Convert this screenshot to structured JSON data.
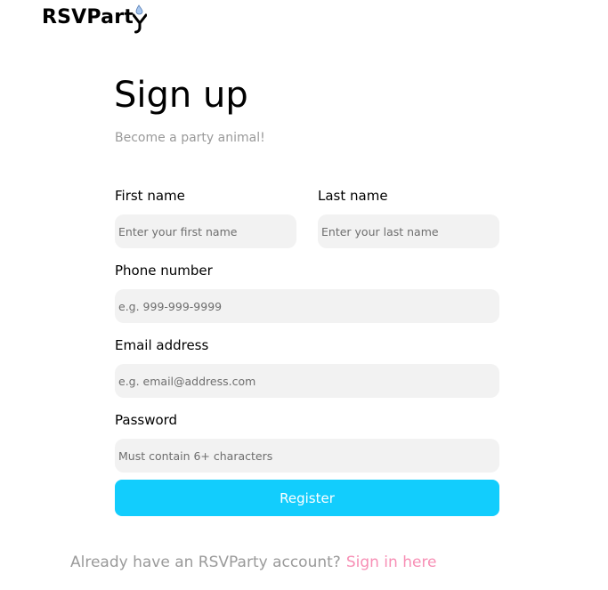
{
  "brand": {
    "name": "RSVParty",
    "text_before_mark": "RSVPart",
    "colors": {
      "accent": "#12cdfd",
      "link": "#f78fb5",
      "muted": "#9a9a9a",
      "field_bg": "#f2f2f2",
      "mark_drop": "#a8c8f0"
    }
  },
  "header": {
    "title": "Sign up",
    "subtitle": "Become a party animal!"
  },
  "form": {
    "first_name": {
      "label": "First name",
      "placeholder": "Enter your first name",
      "value": ""
    },
    "last_name": {
      "label": "Last name",
      "placeholder": "Enter your last name",
      "value": ""
    },
    "phone": {
      "label": "Phone number",
      "placeholder": "e.g. 999-999-9999",
      "value": ""
    },
    "email": {
      "label": "Email address",
      "placeholder": "e.g. email@address.com",
      "value": ""
    },
    "password": {
      "label": "Password",
      "placeholder": "Must contain 6+ characters",
      "value": ""
    },
    "submit_label": "Register"
  },
  "footer": {
    "prompt": "Already have an RSVParty account?",
    "link_label": "Sign in here"
  }
}
